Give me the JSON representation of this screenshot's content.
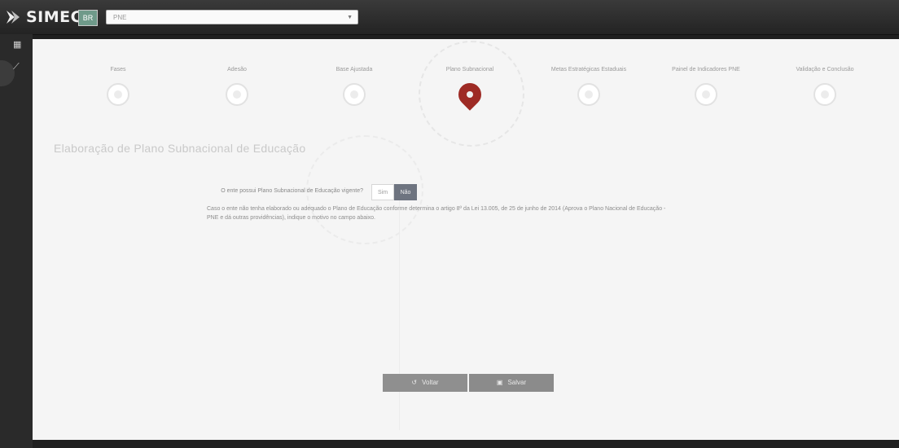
{
  "app": {
    "name": "SIMEC",
    "flag_label": "BR",
    "selector_value": "PNE"
  },
  "sidebar": {
    "items": [
      {
        "icon": "grid-icon",
        "glyph": "▦"
      },
      {
        "icon": "chart-icon",
        "glyph": "⟋"
      }
    ]
  },
  "stepper": {
    "steps": [
      {
        "label": "Fases"
      },
      {
        "label": "Adesão"
      },
      {
        "label": "Base Ajustada"
      },
      {
        "label": "Plano Subnacional"
      },
      {
        "label": "Metas Estratégicas Estaduais"
      },
      {
        "label": "Painel de Indicadores PNE"
      },
      {
        "label": "Validação e Conclusão"
      }
    ],
    "active_index": 3
  },
  "section": {
    "title": "Elaboração de Plano Subnacional de Educação"
  },
  "question": {
    "text": "O ente possui Plano Subnacional de Educação vigente?",
    "yes_label": "Sim",
    "no_label": "Não",
    "selected": "Não"
  },
  "notice": {
    "text": "Caso o ente não tenha elaborado ou adequado o Plano de Educação conforme determina o artigo 8º da Lei 13.005, de 25 de junho de 2014 (Aprova o Plano Nacional de Educação - PNE e dá outras providências), indique o motivo no campo abaixo."
  },
  "actions": {
    "back_label": "Voltar",
    "save_label": "Salvar"
  },
  "colors": {
    "active_step": "#9e2b25",
    "selected_toggle": "#6e7480",
    "button": "#8f8f8f"
  }
}
